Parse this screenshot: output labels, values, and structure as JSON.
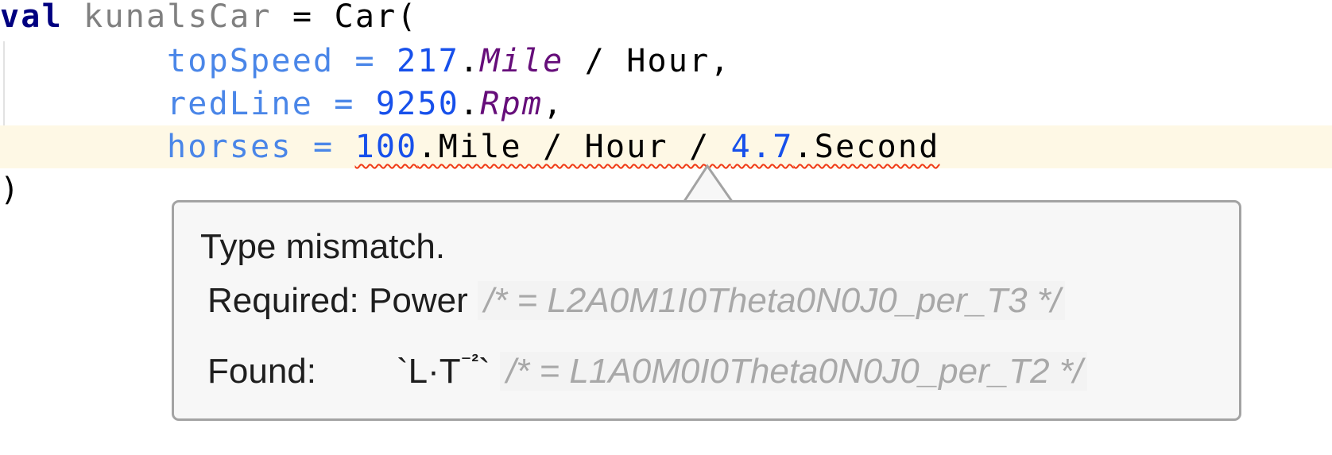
{
  "editor": {
    "lines": {
      "l1": {
        "keyword": "val",
        "name": "kunalsCar",
        "assign": " = ",
        "call": "Car("
      },
      "l2": {
        "param": "topSpeed",
        "eq": " = ",
        "number": "217",
        "dot": ".",
        "ext": "Mile",
        "rest": " / Hour,"
      },
      "l3": {
        "param": "redLine",
        "eq": " = ",
        "number": "9250",
        "dot": ".",
        "ext": "Rpm",
        "rest": ","
      },
      "l4": {
        "param": "horses",
        "eq": " = ",
        "number1": "100",
        "mid": ".Mile / Hour / ",
        "number2": "4.7",
        "rest": ".Second"
      },
      "l5": {
        "close": ")"
      }
    },
    "current_line": 4,
    "error_underline_color": "#F03A17"
  },
  "tooltip": {
    "title": "Type mismatch.",
    "required": {
      "label": "Required: ",
      "type": "Power",
      "comment": "/* = L2A0M1I0Theta0N0J0_per_T3 */"
    },
    "found": {
      "label": "Found:",
      "type_prefix": "`L·T",
      "type_exp": "⁻²",
      "type_suffix": "`",
      "comment": "/* = L1A0M0I0Theta0N0J0_per_T2 */"
    }
  },
  "colors": {
    "keyword": "#000080",
    "unused_identifier": "#808080",
    "named_argument": "#4A86E8",
    "number": "#1750EB",
    "extension_property": "#660E7A",
    "current_line_bg": "#FEF8E5",
    "tooltip_bg": "#F7F7F7",
    "tooltip_border": "#A3A3A3"
  }
}
